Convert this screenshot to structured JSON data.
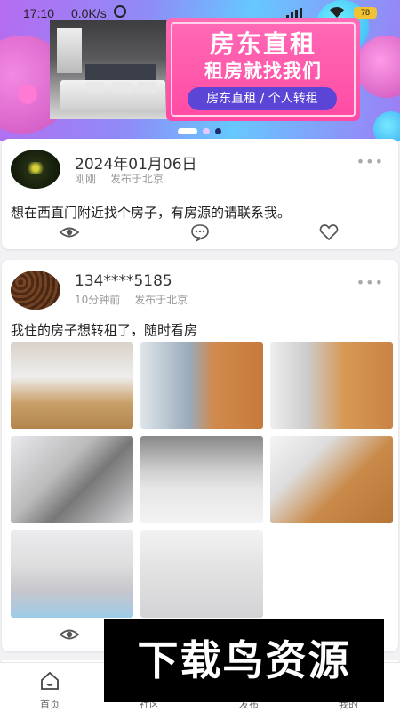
{
  "status_bar": {
    "time": "17:10",
    "speed": "0.0K/s",
    "battery": "78"
  },
  "banner": {
    "title": "房东直租",
    "subtitle": "租房就找我们",
    "pill": "房东直租 / 个人转租",
    "colors": {
      "card": "#ff4aa3",
      "pill": "#5b45d6"
    }
  },
  "posts": [
    {
      "username": "2024年01月06日",
      "time": "刚刚",
      "location": "发布于北京",
      "more": "•••",
      "text": "想在西直门附近找个房子，有房源的请联系我。"
    },
    {
      "username": "134****5185",
      "time": "10分钟前",
      "location": "发布于北京",
      "more": "•••",
      "text": "我住的房子想转租了，随时看房"
    }
  ],
  "watermark": "下载鸟资源",
  "bottom_nav": {
    "items": [
      {
        "label": "首页",
        "icon": "home-icon"
      },
      {
        "label": "社区",
        "icon": "community-icon"
      },
      {
        "label": "发布",
        "icon": "publish-icon"
      },
      {
        "label": "我的",
        "icon": "profile-icon"
      }
    ]
  }
}
